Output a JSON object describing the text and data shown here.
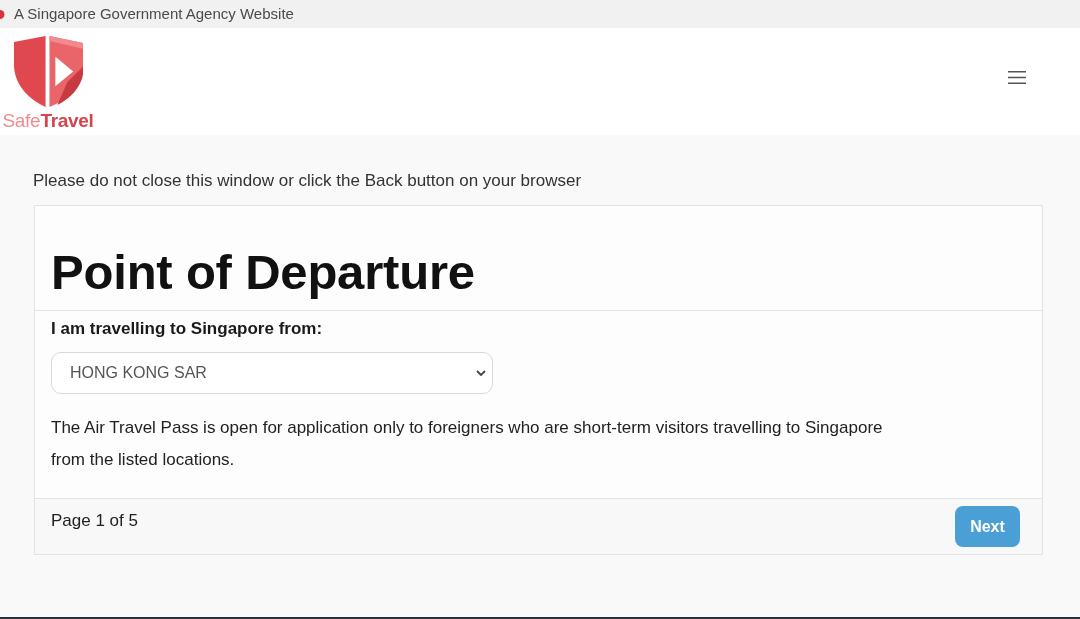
{
  "agency_banner": {
    "text": "A Singapore Government Agency Website"
  },
  "header": {
    "logo_text": "Safe**Travel**"
  },
  "notice": "Please do not close this window or click the Back button on your browser",
  "form": {
    "title": "Point of Departure",
    "field": {
      "label": "I am travelling to Singapore from:",
      "value": "HONG KONG SAR"
    },
    "description": "The Air Travel Pass is open for application only to foreigners who are short-term visitors travelling to Singapore from the listed locations.",
    "footer": {
      "page_indicator": "Page 1 of 5",
      "next_button": "Next"
    }
  }
}
